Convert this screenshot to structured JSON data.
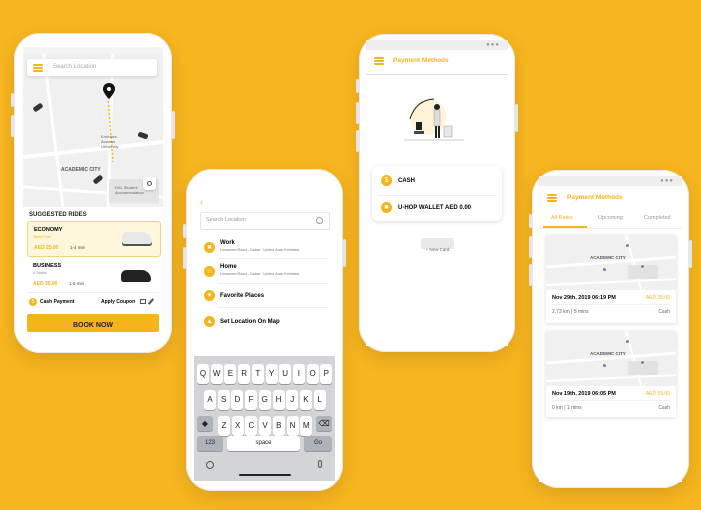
{
  "phone1": {
    "search_placeholder": "Search Location",
    "map_labels": {
      "emirates": "Emirates",
      "aviation": "Aviation",
      "university": "University",
      "academic_city": "ACADEMIC CITY",
      "dxu": "DXL Student",
      "dxu2": "Accommodation"
    },
    "suggested_title": "SUGGESTED RIDES",
    "rides": [
      {
        "name": "ECONOMY",
        "sub": "Best Fare",
        "price": "AED 25.00",
        "eta": "1-4 min"
      },
      {
        "name": "BUSINESS",
        "sub": "4 Seats",
        "price": "AED 35.00",
        "eta": "1-5 min"
      }
    ],
    "cash_label": "Cash Payment",
    "coupon_label": "Apply Coupon",
    "book_label": "BOOK NOW"
  },
  "phone2": {
    "search_placeholder": "Search Location",
    "items": [
      {
        "label": "Work",
        "sub": "Unnamed Road - Dubai - United Arab Emirates"
      },
      {
        "label": "Home",
        "sub": "Unnamed Road - Dubai - United Arab Emirates"
      },
      {
        "label": "Favorite Places",
        "sub": ""
      },
      {
        "label": "Set Location On Map",
        "sub": ""
      }
    ],
    "keyboard": {
      "row1": [
        "Q",
        "W",
        "E",
        "R",
        "T",
        "Y",
        "U",
        "I",
        "O",
        "P"
      ],
      "row2": [
        "A",
        "S",
        "D",
        "F",
        "G",
        "H",
        "J",
        "K",
        "L"
      ],
      "row3": [
        "Z",
        "X",
        "C",
        "V",
        "B",
        "N",
        "M"
      ],
      "k123": "123",
      "space": "space",
      "go": "Go"
    }
  },
  "phone3": {
    "title": "Payment Methods",
    "methods": [
      {
        "label": "CASH"
      },
      {
        "label": "U-HOP WALLET AED 0.00"
      }
    ],
    "new_card": "+ New Card"
  },
  "phone4": {
    "title": "Payment Methods",
    "tabs": [
      "All Rides",
      "Upcoming",
      "Completed"
    ],
    "rides": [
      {
        "date": "Nov 29th, 2019 06:19 PM",
        "price": "AED 25.00",
        "dist": "2.73 km | 5 mins",
        "method": "Cash",
        "map_label": "ACADEMIC CITY"
      },
      {
        "date": "Nov 19th, 2019 06:05 PM",
        "price": "AED 09.00",
        "dist": "0 km | 1 mins",
        "method": "Cash",
        "map_label": "ACADEMIC CITY"
      }
    ]
  }
}
